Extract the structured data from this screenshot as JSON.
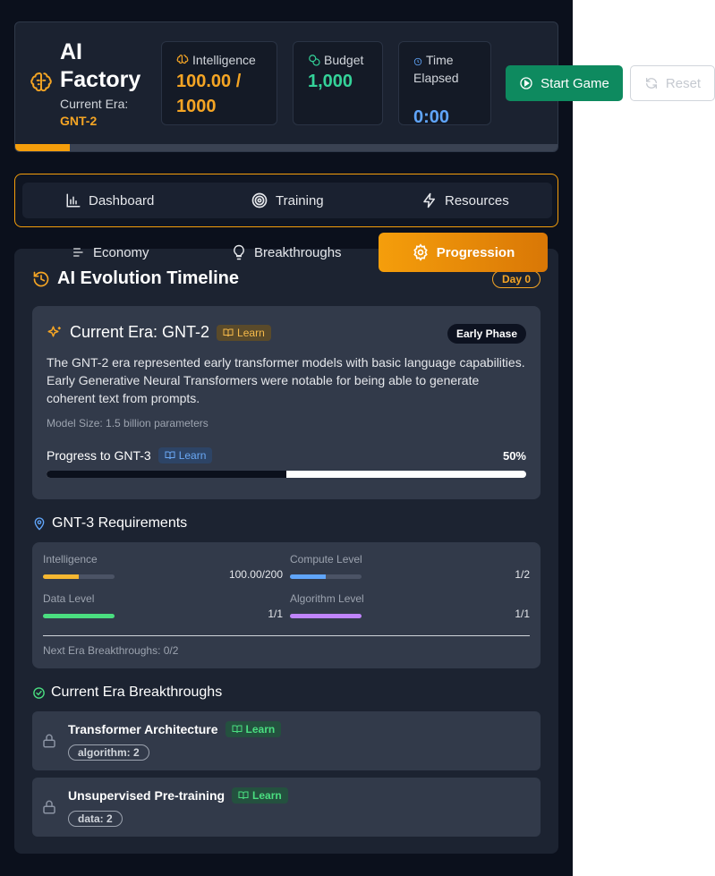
{
  "header": {
    "title": "AI Factory",
    "era_label": "Current Era:",
    "era": "GNT-2",
    "stats": {
      "intelligence_label": "Intelligence",
      "intelligence_value": "100.00 / 1000",
      "budget_label": "Budget",
      "budget_value": "1,000",
      "time_label": "Time Elapsed",
      "time_value": "0:00"
    },
    "progress": 0.1
  },
  "controls": {
    "start_label": "Start Game",
    "reset_label": "Reset"
  },
  "nav": {
    "tabs": [
      "Dashboard",
      "Training",
      "Resources"
    ],
    "tabs2": [
      "Economy",
      "Breakthroughs",
      "Progression"
    ],
    "active": "Progression"
  },
  "panel": {
    "title": "AI Evolution Timeline",
    "day": "Day 0",
    "era_card": {
      "title": "Current Era: GNT-2",
      "learn": "Learn",
      "phase": "Early Phase",
      "description": "The GNT-2 era represented early transformer models with basic language capabilities. Early Generative Neural Transformers were notable for being able to generate coherent text from prompts.",
      "model_size": "Model Size: 1.5 billion parameters",
      "progress_label": "Progress to GNT-3",
      "progress_learn": "Learn",
      "progress_pct": "50%",
      "progress_value": 0.5
    },
    "requirements": {
      "title": "GNT-3 Requirements",
      "items": [
        {
          "name": "Intelligence",
          "value": "100.00/200",
          "fraction": 0.5,
          "color": "#f5b731"
        },
        {
          "name": "Compute Level",
          "value": "1/2",
          "fraction": 0.5,
          "color": "#60a5fa"
        },
        {
          "name": "Data Level",
          "value": "1/1",
          "fraction": 1.0,
          "color": "#4ade80"
        },
        {
          "name": "Algorithm Level",
          "value": "1/1",
          "fraction": 1.0,
          "color": "#c084fc"
        }
      ],
      "next": "Next Era Breakthroughs: 0/2"
    },
    "breakthroughs": {
      "title": "Current Era Breakthroughs",
      "items": [
        {
          "name": "Transformer Architecture",
          "learn": "Learn",
          "tag": "algorithm: 2"
        },
        {
          "name": "Unsupervised Pre-training",
          "learn": "Learn",
          "tag": "data: 2"
        }
      ]
    }
  }
}
